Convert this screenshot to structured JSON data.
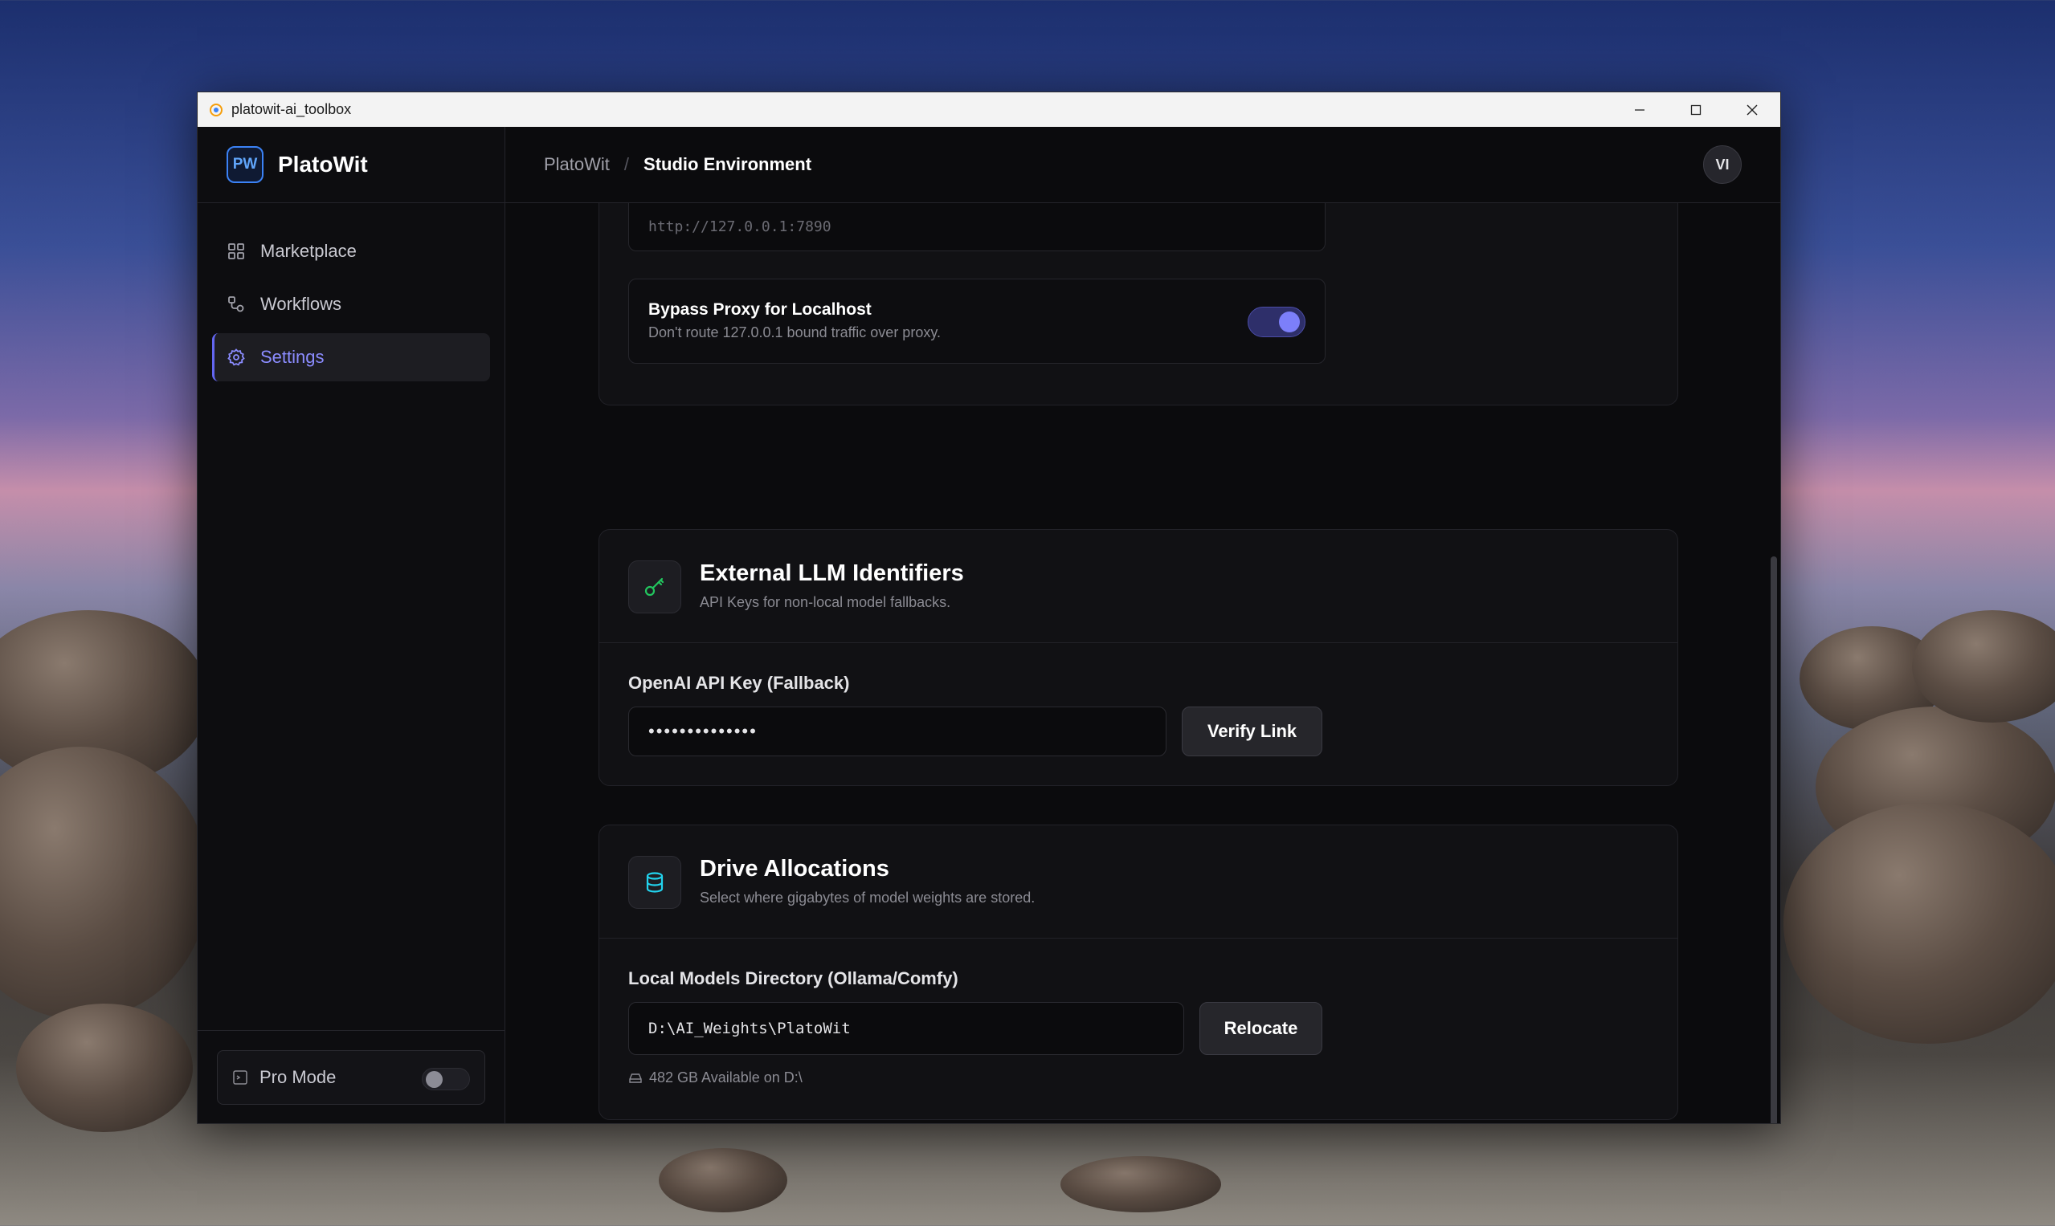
{
  "window": {
    "title": "platowit-ai_toolbox"
  },
  "sidebar": {
    "brand_logo": "PW",
    "brand_name": "PlatoWit",
    "items": [
      {
        "label": "Marketplace",
        "icon": "grid-icon"
      },
      {
        "label": "Workflows",
        "icon": "workflow-icon"
      },
      {
        "label": "Settings",
        "icon": "gear-icon",
        "active": true
      }
    ],
    "pro_mode": {
      "label": "Pro Mode",
      "enabled": false
    }
  },
  "header": {
    "breadcrumb_root": "PlatoWit",
    "breadcrumb_separator": "/",
    "breadcrumb_current": "Studio Environment",
    "avatar_initials": "VI"
  },
  "proxy": {
    "url_value": "http://127.0.0.1:7890",
    "bypass_title": "Bypass Proxy for Localhost",
    "bypass_subtitle": "Don't route 127.0.0.1 bound traffic over proxy.",
    "bypass_enabled": true
  },
  "llm": {
    "title": "External LLM Identifiers",
    "subtitle": "API Keys for non-local model fallbacks.",
    "field_label": "OpenAI API Key (Fallback)",
    "masked_value": "••••••••••••••",
    "verify_label": "Verify Link"
  },
  "drive": {
    "title": "Drive Allocations",
    "subtitle": "Select where gigabytes of model weights are stored.",
    "field_label": "Local Models Directory (Ollama/Comfy)",
    "path_value": "D:\\AI_Weights\\PlatoWit",
    "relocate_label": "Relocate",
    "available_text": "482 GB Available on D:\\"
  },
  "colors": {
    "accent": "#6366f1",
    "llm_icon": "#22c55e",
    "drive_icon": "#22d3ee"
  }
}
